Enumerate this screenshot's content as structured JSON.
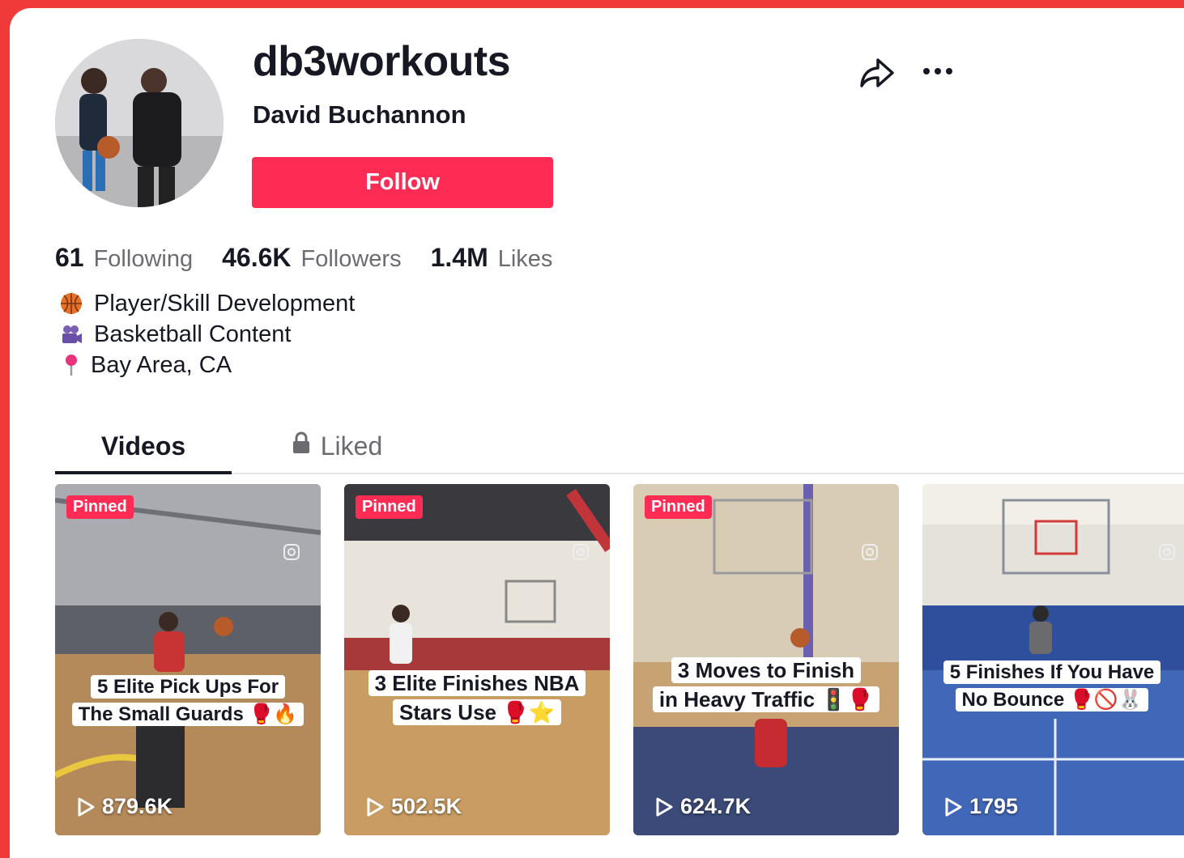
{
  "profile": {
    "username": "db3workouts",
    "nickname": "David Buchannon",
    "follow_label": "Follow"
  },
  "stats": {
    "following_count": "61",
    "following_label": "Following",
    "followers_count": "46.6K",
    "followers_label": "Followers",
    "likes_count": "1.4M",
    "likes_label": "Likes"
  },
  "bio": [
    {
      "icon": "basketball-icon",
      "text": "Player/Skill Development"
    },
    {
      "icon": "camera-icon",
      "text": "Basketball Content"
    },
    {
      "icon": "pin-icon",
      "text": "Bay Area, CA"
    }
  ],
  "tabs": [
    {
      "label": "Videos",
      "active": true
    },
    {
      "label": "Liked",
      "active": false,
      "icon": "lock-icon"
    }
  ],
  "videos": [
    {
      "pinned": "Pinned",
      "caption_line1": "5 Elite Pick Ups For",
      "caption_line2": "The Small Guards 🥊🔥",
      "views": "879.6K"
    },
    {
      "pinned": "Pinned",
      "caption_line1": "3 Elite Finishes NBA",
      "caption_line2": "Stars Use 🥊⭐",
      "views": "502.5K"
    },
    {
      "pinned": "Pinned",
      "caption_line1": "3 Moves to Finish",
      "caption_line2": "in Heavy Traffic 🚦🥊",
      "views": "624.7K"
    },
    {
      "pinned": "",
      "caption_line1": "5 Finishes If You Have",
      "caption_line2": "No Bounce 🥊🚫🐰",
      "views": "1795"
    }
  ],
  "colors": {
    "accent": "#fe2c55",
    "border": "#f03a3a",
    "text": "#161823",
    "muted": "#6b6c72"
  }
}
